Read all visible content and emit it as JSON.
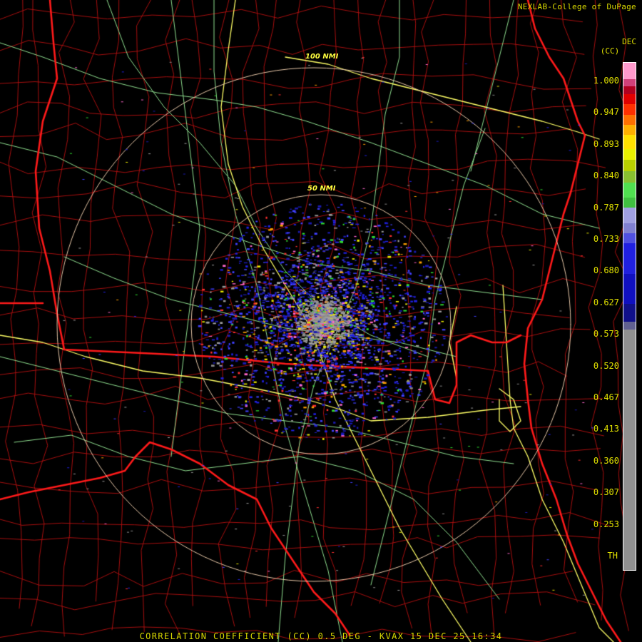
{
  "credit": "NEXLAB-College of DuPage",
  "product": {
    "code": "DEC",
    "unit": "(CC)"
  },
  "footer_text": "CORRELATION COEFFICIENT (CC) 0.5 DEG - KVAX 15 DEC 25 16:34",
  "range_rings": [
    {
      "label": "100 NMI",
      "distance_nmi": 100
    },
    {
      "label": "50 NMI",
      "distance_nmi": 50
    }
  ],
  "legend": {
    "ticks": [
      "1.000",
      "0.947",
      "0.893",
      "0.840",
      "0.787",
      "0.733",
      "0.680",
      "0.627",
      "0.573",
      "0.520",
      "0.467",
      "0.413",
      "0.360",
      "0.307",
      "0.253",
      "TH"
    ],
    "color_bands": [
      {
        "color": "#ff99cc",
        "fraction": 0.032
      },
      {
        "color": "#d0407a",
        "fraction": 0.015
      },
      {
        "color": "#b00020",
        "fraction": 0.015
      },
      {
        "color": "#e00000",
        "fraction": 0.02
      },
      {
        "color": "#ff3000",
        "fraction": 0.02
      },
      {
        "color": "#ff7000",
        "fraction": 0.02
      },
      {
        "color": "#ffb000",
        "fraction": 0.02
      },
      {
        "color": "#ffe000",
        "fraction": 0.028
      },
      {
        "color": "#e8f000",
        "fraction": 0.022
      },
      {
        "color": "#b8d000",
        "fraction": 0.022
      },
      {
        "color": "#88c030",
        "fraction": 0.022
      },
      {
        "color": "#50e050",
        "fraction": 0.03
      },
      {
        "color": "#40c040",
        "fraction": 0.02
      },
      {
        "color": "#a0a0e0",
        "fraction": 0.03
      },
      {
        "color": "#8080d0",
        "fraction": 0.02
      },
      {
        "color": "#5050e0",
        "fraction": 0.02
      },
      {
        "color": "#2020e0",
        "fraction": 0.06
      },
      {
        "color": "#1010c0",
        "fraction": 0.06
      },
      {
        "color": "#10108a",
        "fraction": 0.035
      },
      {
        "color": "#606090",
        "fraction": 0.015
      },
      {
        "color": "#909090",
        "fraction": 0.492
      },
      {
        "color": "#000000",
        "fraction": 0.02
      }
    ]
  },
  "colors": {
    "state_border": "#ff1a1a",
    "county_border": "#b01010",
    "interstate": "#ffff66",
    "highway": "#90e090",
    "range_ring": "#e8c8a8",
    "text": "#e0e000"
  }
}
